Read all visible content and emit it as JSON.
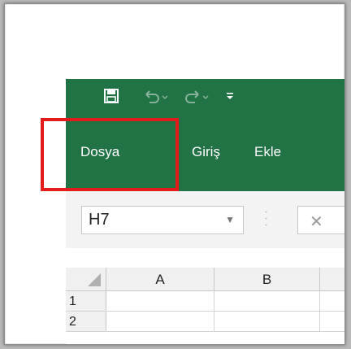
{
  "quick_access": {
    "save_icon": "save-icon",
    "undo_icon": "undo-icon",
    "redo_icon": "redo-icon",
    "customize_icon": "customize-toolbar-icon"
  },
  "tabs": [
    {
      "label": "Dosya"
    },
    {
      "label": "Giriş"
    },
    {
      "label": "Ekle"
    }
  ],
  "formula_bar": {
    "name_box": "H7",
    "cancel_symbol": "✕"
  },
  "grid": {
    "columns": [
      "A",
      "B"
    ],
    "rows": [
      "1",
      "2"
    ]
  },
  "colors": {
    "ribbon": "#217346",
    "highlight": "#e31b1b"
  }
}
